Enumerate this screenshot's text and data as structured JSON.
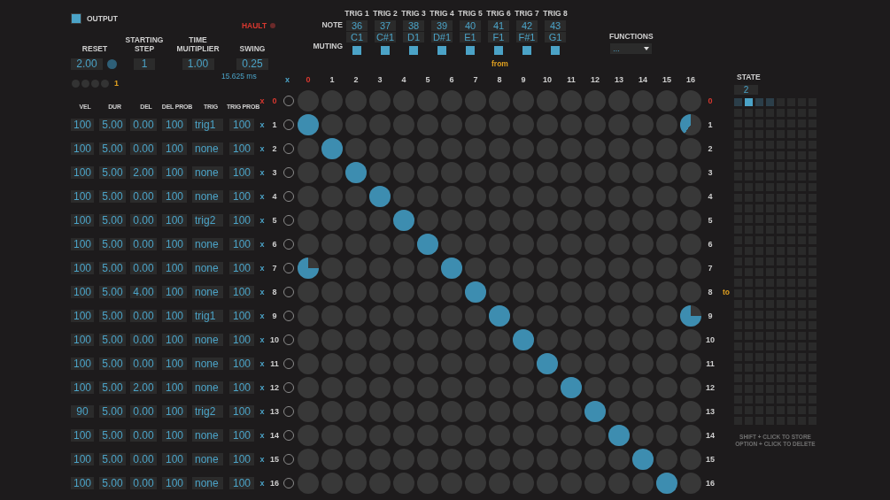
{
  "output": {
    "label": "OUTPUT",
    "checked": true
  },
  "hault": {
    "label": "HAULT"
  },
  "controls": [
    {
      "label": "RESET",
      "value": "2.00",
      "kind": "reset"
    },
    {
      "label": "STARTING STEP",
      "value": "1",
      "kind": "plain"
    },
    {
      "label": "TIME MUITIPLIER",
      "value": "1.00",
      "kind": "plain"
    },
    {
      "label": "SWING",
      "value": "0.25",
      "kind": "swing",
      "note": "15.625 ms"
    }
  ],
  "reset_dots": [
    {
      "on": false
    },
    {
      "on": false
    },
    {
      "on": false
    },
    {
      "on": false
    }
  ],
  "reset_count": "1",
  "triggers": {
    "note_label": "NOTE",
    "muting_label": "MUTING",
    "items": [
      {
        "label": "TRIG 1",
        "note": "36",
        "name": "C1",
        "checked": true
      },
      {
        "label": "TRIG 2",
        "note": "37",
        "name": "C#1",
        "checked": true
      },
      {
        "label": "TRIG 3",
        "note": "38",
        "name": "D1",
        "checked": true
      },
      {
        "label": "TRIG 4",
        "note": "39",
        "name": "D#1",
        "checked": true
      },
      {
        "label": "TRIG 5",
        "note": "40",
        "name": "E1",
        "checked": true
      },
      {
        "label": "TRIG 6",
        "note": "41",
        "name": "F1",
        "checked": true
      },
      {
        "label": "TRIG 7",
        "note": "42",
        "name": "F#1",
        "checked": true
      },
      {
        "label": "TRIG 8",
        "note": "43",
        "name": "G1",
        "checked": true
      }
    ]
  },
  "functions": {
    "label": "FUNCTIONS",
    "value": "..."
  },
  "from_label": "from",
  "param_columns": [
    "VEL",
    "DUR",
    "DEL",
    "DEL PROB",
    "TRIG",
    "TRIG PROB"
  ],
  "matrix": {
    "corner": "x",
    "columns": [
      {
        "label": "0",
        "highlight": true
      },
      {
        "label": "1",
        "highlight": false
      },
      {
        "label": "2",
        "highlight": false
      },
      {
        "label": "3",
        "highlight": false
      },
      {
        "label": "4",
        "highlight": false
      },
      {
        "label": "5",
        "highlight": false
      },
      {
        "label": "6",
        "highlight": false
      },
      {
        "label": "7",
        "highlight": false
      },
      {
        "label": "8",
        "highlight": false
      },
      {
        "label": "9",
        "highlight": false
      },
      {
        "label": "10",
        "highlight": false
      },
      {
        "label": "11",
        "highlight": false
      },
      {
        "label": "12",
        "highlight": false
      },
      {
        "label": "13",
        "highlight": false
      },
      {
        "label": "14",
        "highlight": false
      },
      {
        "label": "15",
        "highlight": false
      },
      {
        "label": "16",
        "highlight": false
      }
    ],
    "rows": [
      {
        "mark": "x",
        "label": "0",
        "right_label": "0",
        "highlight": true,
        "on": false,
        "cells": [
          {
            "kind": "empty"
          },
          {
            "kind": "empty"
          },
          {
            "kind": "empty"
          },
          {
            "kind": "empty"
          },
          {
            "kind": "empty"
          },
          {
            "kind": "empty"
          },
          {
            "kind": "empty"
          },
          {
            "kind": "empty"
          },
          {
            "kind": "empty"
          },
          {
            "kind": "empty"
          },
          {
            "kind": "empty"
          },
          {
            "kind": "empty"
          },
          {
            "kind": "empty"
          },
          {
            "kind": "empty"
          },
          {
            "kind": "empty"
          },
          {
            "kind": "empty"
          },
          {
            "kind": "empty"
          }
        ]
      },
      {
        "mark": "x",
        "label": "1",
        "right_label": "1",
        "highlight": false,
        "on": false,
        "params": [
          "100",
          "5.00",
          "0.00",
          "100",
          "trig1",
          "100"
        ],
        "cells": [
          {
            "kind": "full"
          },
          {
            "kind": "empty"
          },
          {
            "kind": "empty"
          },
          {
            "kind": "empty"
          },
          {
            "kind": "empty"
          },
          {
            "kind": "empty"
          },
          {
            "kind": "empty"
          },
          {
            "kind": "empty"
          },
          {
            "kind": "empty"
          },
          {
            "kind": "empty"
          },
          {
            "kind": "empty"
          },
          {
            "kind": "empty"
          },
          {
            "kind": "empty"
          },
          {
            "kind": "empty"
          },
          {
            "kind": "empty"
          },
          {
            "kind": "empty"
          },
          {
            "kind": "twofifths"
          }
        ]
      },
      {
        "mark": "x",
        "label": "2",
        "right_label": "2",
        "highlight": false,
        "on": false,
        "params": [
          "100",
          "5.00",
          "0.00",
          "100",
          "none",
          "100"
        ],
        "cells": [
          {
            "kind": "empty"
          },
          {
            "kind": "full"
          },
          {
            "kind": "empty"
          },
          {
            "kind": "empty"
          },
          {
            "kind": "empty"
          },
          {
            "kind": "empty"
          },
          {
            "kind": "empty"
          },
          {
            "kind": "empty"
          },
          {
            "kind": "empty"
          },
          {
            "kind": "empty"
          },
          {
            "kind": "empty"
          },
          {
            "kind": "empty"
          },
          {
            "kind": "empty"
          },
          {
            "kind": "empty"
          },
          {
            "kind": "empty"
          },
          {
            "kind": "empty"
          },
          {
            "kind": "empty"
          }
        ]
      },
      {
        "mark": "x",
        "label": "3",
        "right_label": "3",
        "highlight": false,
        "on": false,
        "params": [
          "100",
          "5.00",
          "2.00",
          "100",
          "none",
          "100"
        ],
        "cells": [
          {
            "kind": "empty"
          },
          {
            "kind": "empty"
          },
          {
            "kind": "full"
          },
          {
            "kind": "empty"
          },
          {
            "kind": "empty"
          },
          {
            "kind": "empty"
          },
          {
            "kind": "empty"
          },
          {
            "kind": "empty"
          },
          {
            "kind": "empty"
          },
          {
            "kind": "empty"
          },
          {
            "kind": "empty"
          },
          {
            "kind": "empty"
          },
          {
            "kind": "empty"
          },
          {
            "kind": "empty"
          },
          {
            "kind": "empty"
          },
          {
            "kind": "empty"
          },
          {
            "kind": "empty"
          }
        ]
      },
      {
        "mark": "x",
        "label": "4",
        "right_label": "4",
        "highlight": false,
        "on": false,
        "params": [
          "100",
          "5.00",
          "0.00",
          "100",
          "none",
          "100"
        ],
        "cells": [
          {
            "kind": "empty"
          },
          {
            "kind": "empty"
          },
          {
            "kind": "empty"
          },
          {
            "kind": "full"
          },
          {
            "kind": "empty"
          },
          {
            "kind": "empty"
          },
          {
            "kind": "empty"
          },
          {
            "kind": "empty"
          },
          {
            "kind": "empty"
          },
          {
            "kind": "empty"
          },
          {
            "kind": "empty"
          },
          {
            "kind": "empty"
          },
          {
            "kind": "empty"
          },
          {
            "kind": "empty"
          },
          {
            "kind": "empty"
          },
          {
            "kind": "empty"
          },
          {
            "kind": "empty"
          }
        ]
      },
      {
        "mark": "x",
        "label": "5",
        "right_label": "5",
        "highlight": false,
        "on": false,
        "params": [
          "100",
          "5.00",
          "0.00",
          "100",
          "trig2",
          "100"
        ],
        "cells": [
          {
            "kind": "empty"
          },
          {
            "kind": "empty"
          },
          {
            "kind": "empty"
          },
          {
            "kind": "empty"
          },
          {
            "kind": "full"
          },
          {
            "kind": "empty"
          },
          {
            "kind": "empty"
          },
          {
            "kind": "empty"
          },
          {
            "kind": "empty"
          },
          {
            "kind": "empty"
          },
          {
            "kind": "empty"
          },
          {
            "kind": "empty"
          },
          {
            "kind": "empty"
          },
          {
            "kind": "empty"
          },
          {
            "kind": "empty"
          },
          {
            "kind": "empty"
          },
          {
            "kind": "empty"
          }
        ]
      },
      {
        "mark": "x",
        "label": "6",
        "right_label": "6",
        "highlight": false,
        "on": false,
        "params": [
          "100",
          "5.00",
          "0.00",
          "100",
          "none",
          "100"
        ],
        "cells": [
          {
            "kind": "empty"
          },
          {
            "kind": "empty"
          },
          {
            "kind": "empty"
          },
          {
            "kind": "empty"
          },
          {
            "kind": "empty"
          },
          {
            "kind": "full"
          },
          {
            "kind": "empty"
          },
          {
            "kind": "empty"
          },
          {
            "kind": "empty"
          },
          {
            "kind": "empty"
          },
          {
            "kind": "empty"
          },
          {
            "kind": "empty"
          },
          {
            "kind": "empty"
          },
          {
            "kind": "empty"
          },
          {
            "kind": "empty"
          },
          {
            "kind": "empty"
          },
          {
            "kind": "empty"
          }
        ]
      },
      {
        "mark": "x",
        "label": "7",
        "right_label": "7",
        "highlight": false,
        "on": false,
        "params": [
          "100",
          "5.00",
          "0.00",
          "100",
          "none",
          "100"
        ],
        "cells": [
          {
            "kind": "threequarter"
          },
          {
            "kind": "empty"
          },
          {
            "kind": "empty"
          },
          {
            "kind": "empty"
          },
          {
            "kind": "empty"
          },
          {
            "kind": "empty"
          },
          {
            "kind": "full"
          },
          {
            "kind": "empty"
          },
          {
            "kind": "empty"
          },
          {
            "kind": "empty"
          },
          {
            "kind": "empty"
          },
          {
            "kind": "empty"
          },
          {
            "kind": "empty"
          },
          {
            "kind": "empty"
          },
          {
            "kind": "empty"
          },
          {
            "kind": "empty"
          },
          {
            "kind": "empty"
          }
        ]
      },
      {
        "mark": "x",
        "label": "8",
        "right_label": "8",
        "side_note": "to",
        "highlight": false,
        "on": false,
        "params": [
          "100",
          "5.00",
          "4.00",
          "100",
          "none",
          "100"
        ],
        "cells": [
          {
            "kind": "empty"
          },
          {
            "kind": "empty"
          },
          {
            "kind": "empty"
          },
          {
            "kind": "empty"
          },
          {
            "kind": "empty"
          },
          {
            "kind": "empty"
          },
          {
            "kind": "empty"
          },
          {
            "kind": "full"
          },
          {
            "kind": "empty"
          },
          {
            "kind": "empty"
          },
          {
            "kind": "empty"
          },
          {
            "kind": "empty"
          },
          {
            "kind": "empty"
          },
          {
            "kind": "empty"
          },
          {
            "kind": "empty"
          },
          {
            "kind": "empty"
          },
          {
            "kind": "empty"
          }
        ]
      },
      {
        "mark": "x",
        "label": "9",
        "right_label": "9",
        "highlight": false,
        "on": false,
        "params": [
          "100",
          "5.00",
          "0.00",
          "100",
          "trig1",
          "100"
        ],
        "cells": [
          {
            "kind": "empty"
          },
          {
            "kind": "empty"
          },
          {
            "kind": "empty"
          },
          {
            "kind": "empty"
          },
          {
            "kind": "empty"
          },
          {
            "kind": "empty"
          },
          {
            "kind": "empty"
          },
          {
            "kind": "empty"
          },
          {
            "kind": "full"
          },
          {
            "kind": "empty"
          },
          {
            "kind": "empty"
          },
          {
            "kind": "empty"
          },
          {
            "kind": "empty"
          },
          {
            "kind": "empty"
          },
          {
            "kind": "empty"
          },
          {
            "kind": "empty"
          },
          {
            "kind": "threequarter"
          }
        ]
      },
      {
        "mark": "x",
        "label": "10",
        "right_label": "10",
        "highlight": false,
        "on": false,
        "params": [
          "100",
          "5.00",
          "0.00",
          "100",
          "none",
          "100"
        ],
        "cells": [
          {
            "kind": "empty"
          },
          {
            "kind": "empty"
          },
          {
            "kind": "empty"
          },
          {
            "kind": "empty"
          },
          {
            "kind": "empty"
          },
          {
            "kind": "empty"
          },
          {
            "kind": "empty"
          },
          {
            "kind": "empty"
          },
          {
            "kind": "empty"
          },
          {
            "kind": "full"
          },
          {
            "kind": "empty"
          },
          {
            "kind": "empty"
          },
          {
            "kind": "empty"
          },
          {
            "kind": "empty"
          },
          {
            "kind": "empty"
          },
          {
            "kind": "empty"
          },
          {
            "kind": "empty"
          }
        ]
      },
      {
        "mark": "x",
        "label": "11",
        "right_label": "11",
        "highlight": false,
        "on": false,
        "params": [
          "100",
          "5.00",
          "0.00",
          "100",
          "none",
          "100"
        ],
        "cells": [
          {
            "kind": "empty"
          },
          {
            "kind": "empty"
          },
          {
            "kind": "empty"
          },
          {
            "kind": "empty"
          },
          {
            "kind": "empty"
          },
          {
            "kind": "empty"
          },
          {
            "kind": "empty"
          },
          {
            "kind": "empty"
          },
          {
            "kind": "empty"
          },
          {
            "kind": "empty"
          },
          {
            "kind": "full"
          },
          {
            "kind": "empty"
          },
          {
            "kind": "empty"
          },
          {
            "kind": "empty"
          },
          {
            "kind": "empty"
          },
          {
            "kind": "empty"
          },
          {
            "kind": "empty"
          }
        ]
      },
      {
        "mark": "x",
        "label": "12",
        "right_label": "12",
        "highlight": false,
        "on": false,
        "params": [
          "100",
          "5.00",
          "2.00",
          "100",
          "none",
          "100"
        ],
        "cells": [
          {
            "kind": "empty"
          },
          {
            "kind": "empty"
          },
          {
            "kind": "empty"
          },
          {
            "kind": "empty"
          },
          {
            "kind": "empty"
          },
          {
            "kind": "empty"
          },
          {
            "kind": "empty"
          },
          {
            "kind": "empty"
          },
          {
            "kind": "empty"
          },
          {
            "kind": "empty"
          },
          {
            "kind": "empty"
          },
          {
            "kind": "full"
          },
          {
            "kind": "empty"
          },
          {
            "kind": "empty"
          },
          {
            "kind": "empty"
          },
          {
            "kind": "empty"
          },
          {
            "kind": "empty"
          }
        ]
      },
      {
        "mark": "x",
        "label": "13",
        "right_label": "13",
        "highlight": false,
        "on": false,
        "params": [
          "90",
          "5.00",
          "0.00",
          "100",
          "trig2",
          "100"
        ],
        "cells": [
          {
            "kind": "empty"
          },
          {
            "kind": "empty"
          },
          {
            "kind": "empty"
          },
          {
            "kind": "empty"
          },
          {
            "kind": "empty"
          },
          {
            "kind": "empty"
          },
          {
            "kind": "empty"
          },
          {
            "kind": "empty"
          },
          {
            "kind": "empty"
          },
          {
            "kind": "empty"
          },
          {
            "kind": "empty"
          },
          {
            "kind": "empty"
          },
          {
            "kind": "full"
          },
          {
            "kind": "empty"
          },
          {
            "kind": "empty"
          },
          {
            "kind": "empty"
          },
          {
            "kind": "empty"
          }
        ]
      },
      {
        "mark": "x",
        "label": "14",
        "right_label": "14",
        "highlight": false,
        "on": false,
        "params": [
          "100",
          "5.00",
          "0.00",
          "100",
          "none",
          "100"
        ],
        "cells": [
          {
            "kind": "empty"
          },
          {
            "kind": "empty"
          },
          {
            "kind": "empty"
          },
          {
            "kind": "empty"
          },
          {
            "kind": "empty"
          },
          {
            "kind": "empty"
          },
          {
            "kind": "empty"
          },
          {
            "kind": "empty"
          },
          {
            "kind": "empty"
          },
          {
            "kind": "empty"
          },
          {
            "kind": "empty"
          },
          {
            "kind": "empty"
          },
          {
            "kind": "empty"
          },
          {
            "kind": "full"
          },
          {
            "kind": "empty"
          },
          {
            "kind": "empty"
          },
          {
            "kind": "empty"
          }
        ]
      },
      {
        "mark": "x",
        "label": "15",
        "right_label": "15",
        "highlight": false,
        "on": false,
        "params": [
          "100",
          "5.00",
          "0.00",
          "100",
          "none",
          "100"
        ],
        "cells": [
          {
            "kind": "empty"
          },
          {
            "kind": "empty"
          },
          {
            "kind": "empty"
          },
          {
            "kind": "empty"
          },
          {
            "kind": "empty"
          },
          {
            "kind": "empty"
          },
          {
            "kind": "empty"
          },
          {
            "kind": "empty"
          },
          {
            "kind": "empty"
          },
          {
            "kind": "empty"
          },
          {
            "kind": "empty"
          },
          {
            "kind": "empty"
          },
          {
            "kind": "empty"
          },
          {
            "kind": "empty"
          },
          {
            "kind": "full"
          },
          {
            "kind": "empty"
          },
          {
            "kind": "empty"
          }
        ]
      },
      {
        "mark": "x",
        "label": "16",
        "right_label": "16",
        "highlight": false,
        "on": false,
        "params": [
          "100",
          "5.00",
          "0.00",
          "100",
          "none",
          "100"
        ],
        "cells": [
          {
            "kind": "empty"
          },
          {
            "kind": "empty"
          },
          {
            "kind": "empty"
          },
          {
            "kind": "empty"
          },
          {
            "kind": "empty"
          },
          {
            "kind": "empty"
          },
          {
            "kind": "empty"
          },
          {
            "kind": "empty"
          },
          {
            "kind": "empty"
          },
          {
            "kind": "empty"
          },
          {
            "kind": "empty"
          },
          {
            "kind": "empty"
          },
          {
            "kind": "empty"
          },
          {
            "kind": "empty"
          },
          {
            "kind": "empty"
          },
          {
            "kind": "full"
          },
          {
            "kind": "empty"
          }
        ]
      }
    ]
  },
  "state": {
    "label": "STATE",
    "value": "2",
    "slots": [
      {
        "stored": true,
        "selected": false
      },
      {
        "stored": true,
        "selected": true
      },
      {
        "stored": true,
        "selected": false
      },
      {
        "stored": true,
        "selected": false
      }
    ],
    "hints": [
      "SHIFT + CLICK TO STORE",
      "OPTION + CLICK TO DELETE"
    ]
  }
}
